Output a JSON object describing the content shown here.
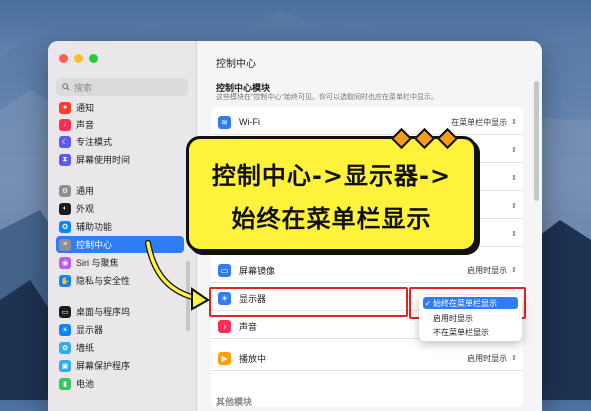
{
  "sidebar": {
    "search_placeholder": "搜索",
    "items": [
      {
        "label": "通知",
        "icon": "bell-icon",
        "color": "#ff3b30"
      },
      {
        "label": "声音",
        "icon": "speaker-icon",
        "color": "#ff2d55"
      },
      {
        "label": "专注模式",
        "icon": "moon-icon",
        "color": "#5e5ce6"
      },
      {
        "label": "屏幕使用时间",
        "icon": "hourglass-icon",
        "color": "#5e5ce6"
      },
      {
        "label": "通用",
        "icon": "gear-icon",
        "color": "#8e8e93"
      },
      {
        "label": "外观",
        "icon": "appearance-icon",
        "color": "#1c1c1e"
      },
      {
        "label": "辅助功能",
        "icon": "accessibility-icon",
        "color": "#0a84ff"
      },
      {
        "label": "控制中心",
        "icon": "control-center-icon",
        "color": "#8e8e93"
      },
      {
        "label": "Siri 与聚焦",
        "icon": "siri-icon",
        "color": "#bf5af2"
      },
      {
        "label": "隐私与安全性",
        "icon": "hand-icon",
        "color": "#0a84ff"
      },
      {
        "label": "桌面与程序坞",
        "icon": "dock-icon",
        "color": "#1c1c1e"
      },
      {
        "label": "显示器",
        "icon": "display-icon",
        "color": "#0a84ff"
      },
      {
        "label": "墙纸",
        "icon": "wallpaper-icon",
        "color": "#32ade6"
      },
      {
        "label": "屏幕保护程序",
        "icon": "screensaver-icon",
        "color": "#32ade6"
      },
      {
        "label": "电池",
        "icon": "battery-icon",
        "color": "#34c759"
      }
    ],
    "active_index": 7
  },
  "main": {
    "title": "控制中心",
    "section_title": "控制中心模块",
    "section_desc": "这些模块在\"控制中心\"始终可见。你可以选取同时也应在菜单栏中显示。",
    "rows": [
      {
        "label": "Wi-Fi",
        "value": "在菜单栏中显示",
        "icon": "wifi-icon"
      },
      {
        "label": "",
        "value": "",
        "icon": "bluetooth-icon"
      },
      {
        "label": "",
        "value": "",
        "icon": "airdrop-icon"
      },
      {
        "label": "",
        "value": "",
        "icon": "focus-icon"
      },
      {
        "label": "",
        "value": "",
        "icon": "stage-icon"
      },
      {
        "label": "屏幕镜像",
        "value": "启用时显示",
        "icon": "mirroring-icon"
      },
      {
        "label": "显示器",
        "value": "",
        "icon": "display-brightness-icon"
      },
      {
        "label": "声音",
        "value": "",
        "icon": "sound-icon"
      },
      {
        "label": "播放中",
        "value": "启用时显示",
        "icon": "now-playing-icon"
      }
    ],
    "next_section": "其他模块"
  },
  "dropdown": {
    "options": [
      "始终在菜单栏显示",
      "启用时显示",
      "不在菜单栏显示"
    ],
    "selected": "始终在菜单栏显示"
  },
  "banner": {
    "line1": "控制中心->显示器->",
    "line2": "始终在菜单栏显示"
  },
  "colors": {
    "accent": "#2f7df6",
    "highlight": "#e02424",
    "banner_bg": "#fff23a",
    "arrow": "#fff23a"
  }
}
